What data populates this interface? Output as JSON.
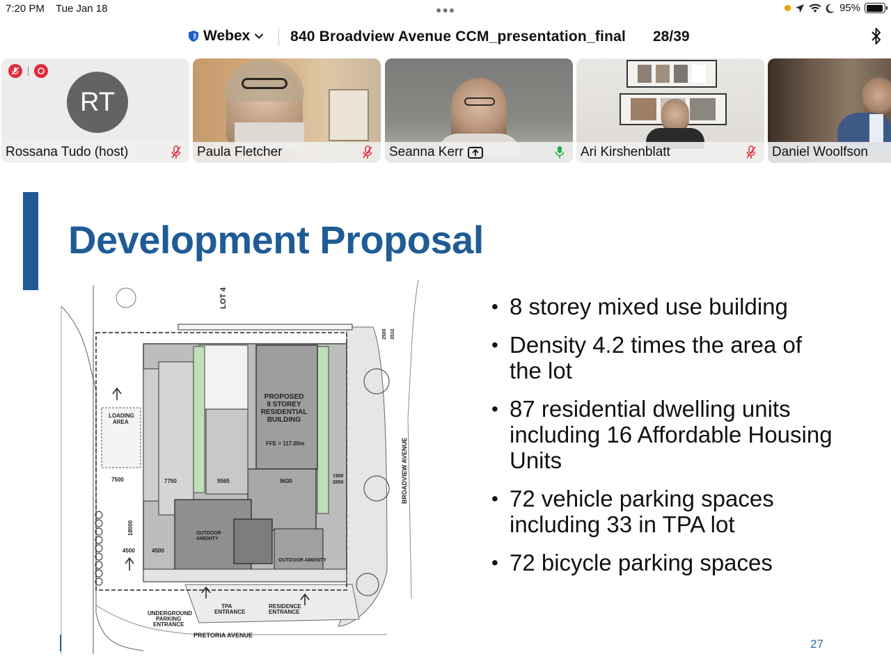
{
  "status_bar": {
    "time": "7:20 PM",
    "date": "Tue Jan 18",
    "battery_percent_label": "95%",
    "battery_level": 0.95,
    "icons": [
      "location-icon",
      "wifi-icon",
      "moon-icon",
      "battery-icon"
    ]
  },
  "header": {
    "app_name": "Webex",
    "meeting_title": "840 Broadview Avenue CCM_presentation_final",
    "page_indicator": "28/39"
  },
  "participants": [
    {
      "name": "Rossana Tudo (host)",
      "initials": "RT",
      "muted": true
    },
    {
      "name": "Paula Fletcher",
      "muted": true
    },
    {
      "name": "Seanna Kerr",
      "muted": false,
      "sharing": true
    },
    {
      "name": "Ari Kirshenblatt",
      "muted": true
    },
    {
      "name": "Daniel Woolfson",
      "muted": false
    }
  ],
  "slide": {
    "title": "Development Proposal",
    "bullets": [
      "8 storey mixed use building",
      "Density 4.2 times the area of the lot",
      "87 residential dwelling units including 16 Affordable Housing Units",
      "72 vehicle parking spaces including 33 in TPA lot",
      "72 bicycle parking spaces"
    ],
    "slide_number": "27",
    "accent_color": "#215b93",
    "title_color": "#1f5c96"
  },
  "site_plan": {
    "labels": {
      "lot": "LOT 4",
      "proposed_1": "PROPOSED",
      "proposed_2": "8 STOREY",
      "proposed_3": "RESIDENTIAL",
      "proposed_4": "BUILDING",
      "ffe": "FFE = 117.00m",
      "loading_1": "LOADING",
      "loading_2": "AREA",
      "broadview": "BROADVIEW AVENUE",
      "pretoria": "PRETORIA AVENUE",
      "underground_1": "UNDERGROUND",
      "underground_2": "PARKING",
      "underground_3": "ENTRANCE",
      "tpa_1": "TPA",
      "tpa_2": "ENTRANCE",
      "residence_1": "RESIDENCE",
      "residence_2": "ENTRANCE",
      "outdoor_amenity_1": "OUTDOOR",
      "outdoor_amenity_2": "AMENITY",
      "outdoor_amenity_3": "OUTDOOR AMENITY",
      "dim_7750": "7750",
      "dim_9565": "9565",
      "dim_9630": "9630",
      "dim_7500": "7500",
      "dim_4500a": "4500",
      "dim_4500b": "4500",
      "dim_18000": "18000",
      "dim_1900": "1900",
      "dim_2850": "2850",
      "dim_2500": "2500",
      "dim_3510": "3510"
    }
  }
}
